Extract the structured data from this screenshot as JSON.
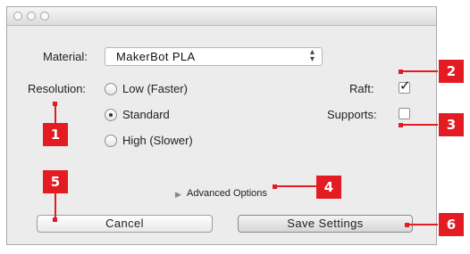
{
  "window": {
    "traffic_lights": [
      "close",
      "minimize",
      "zoom"
    ]
  },
  "material": {
    "label": "Material:",
    "selected": "MakerBot PLA"
  },
  "resolution": {
    "label": "Resolution:",
    "options": [
      {
        "label": "Low (Faster)",
        "selected": false
      },
      {
        "label": "Standard",
        "selected": true
      },
      {
        "label": "High (Slower)",
        "selected": false
      }
    ]
  },
  "raft": {
    "label": "Raft:",
    "checked": true
  },
  "supports": {
    "label": "Supports:",
    "checked": false
  },
  "advanced": {
    "label": "Advanced Options"
  },
  "buttons": {
    "cancel": "Cancel",
    "save": "Save Settings"
  },
  "callouts": [
    "1",
    "2",
    "3",
    "4",
    "5",
    "6"
  ],
  "colors": {
    "callout": "#e31b23",
    "window_bg": "#ececec"
  }
}
